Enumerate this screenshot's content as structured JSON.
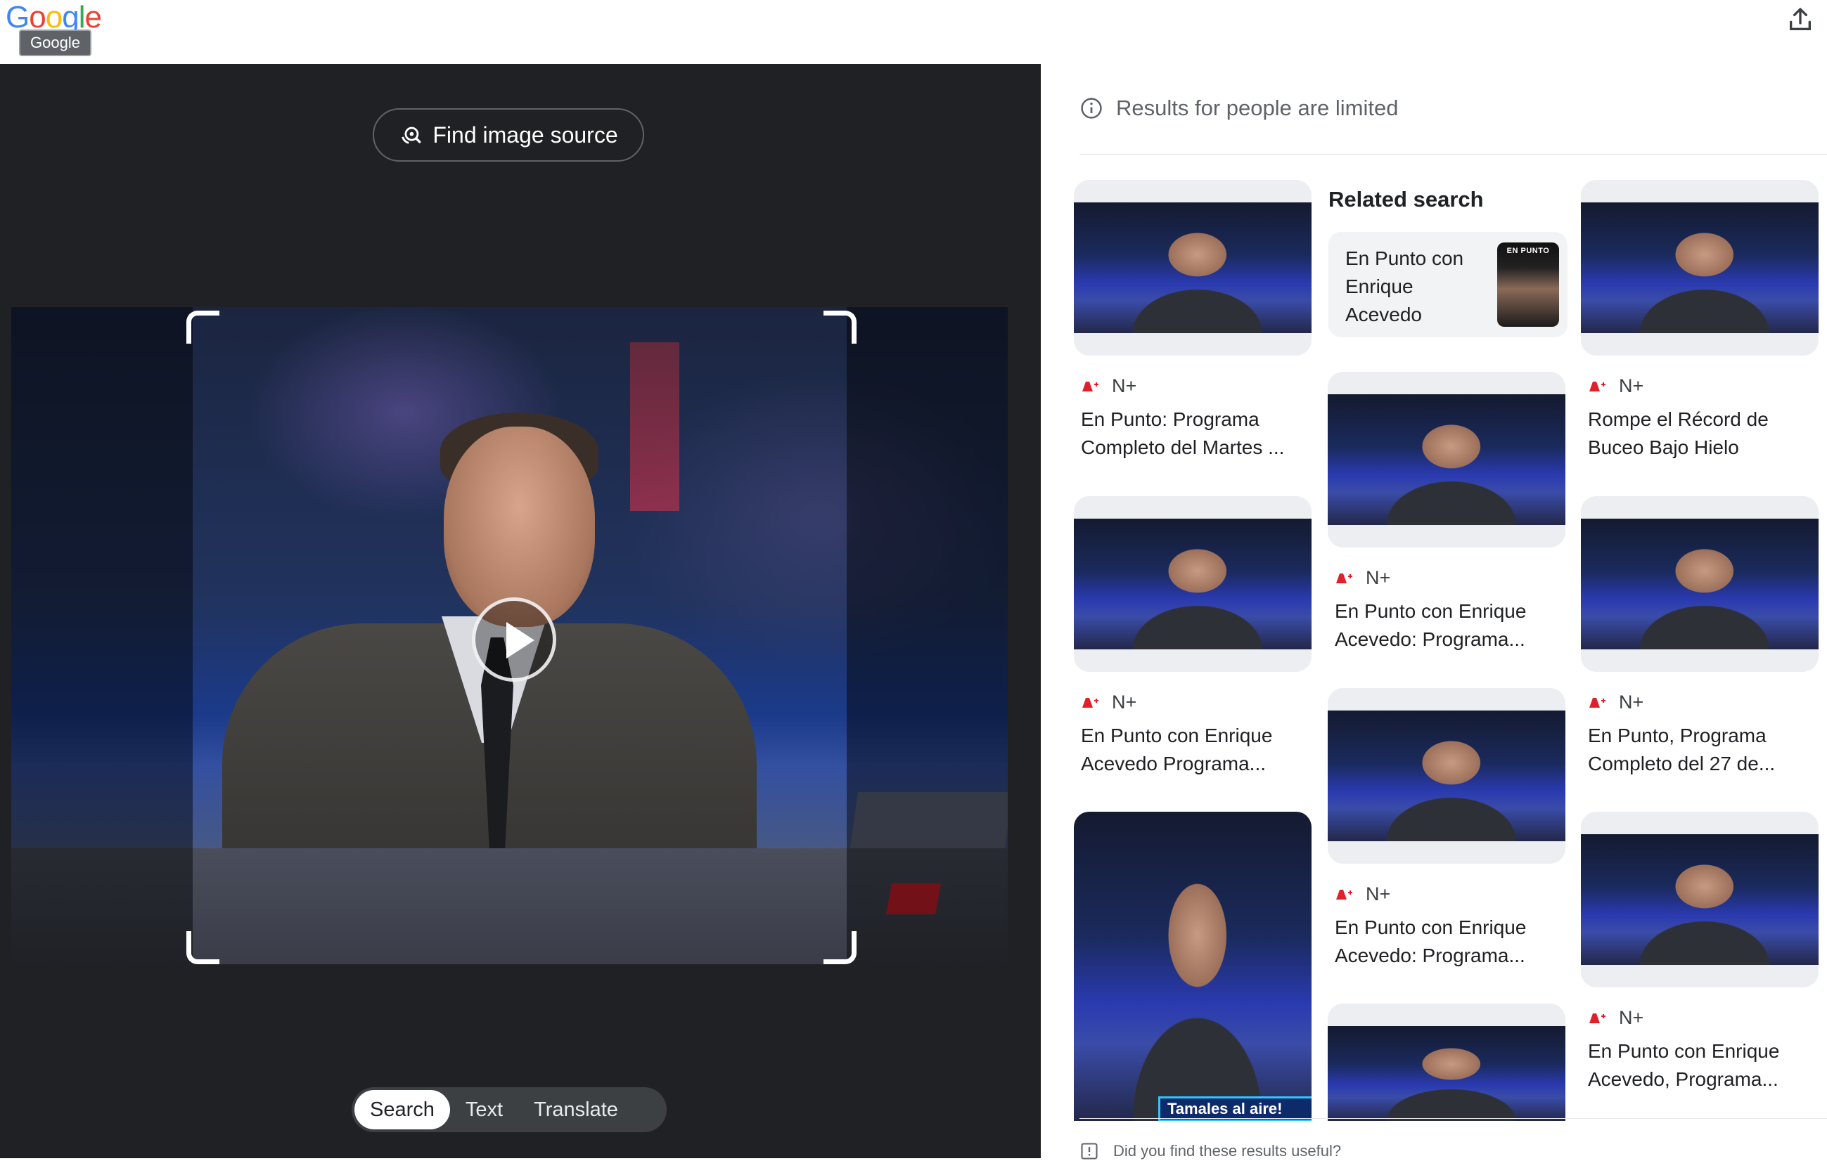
{
  "header": {
    "logo_letters": [
      "G",
      "o",
      "o",
      "g",
      "l",
      "e"
    ],
    "logo_colors": [
      "#4285F4",
      "#EA4335",
      "#FBBC05",
      "#4285F4",
      "#34A853",
      "#EA4335"
    ],
    "logo_tooltip": "Google",
    "share_icon": "share-upload-icon"
  },
  "lens": {
    "find_source_label": "Find image source",
    "modes": [
      "Search",
      "Text",
      "Translate"
    ],
    "active_mode": "Search"
  },
  "results": {
    "limited_notice": "Results for people are limited",
    "related_heading": "Related search",
    "related_query": "En Punto con Enrique Acevedo",
    "related_thumb_label": "EN PUNTO",
    "source_name": "N+",
    "columns": {
      "col1": [
        {
          "title": "En Punto: Programa Completo del Martes ..."
        },
        {
          "title": "En Punto con Enrique Acevedo Programa..."
        },
        {
          "title": ""
        }
      ],
      "col2": [
        {
          "title": "En Punto con Enrique Acevedo: Programa..."
        },
        {
          "title": "En Punto con Enrique Acevedo: Programa..."
        },
        {
          "title": ""
        }
      ],
      "col3": [
        {
          "title": "Rompe el Récord de Buceo Bajo Hielo"
        },
        {
          "title": "En Punto, Programa Completo del 27 de..."
        },
        {
          "title": "En Punto con Enrique Acevedo, Programa..."
        }
      ]
    },
    "col1_overlay_text": "Tamales al aire!",
    "feedback_text": "Did you find these results useful?"
  }
}
